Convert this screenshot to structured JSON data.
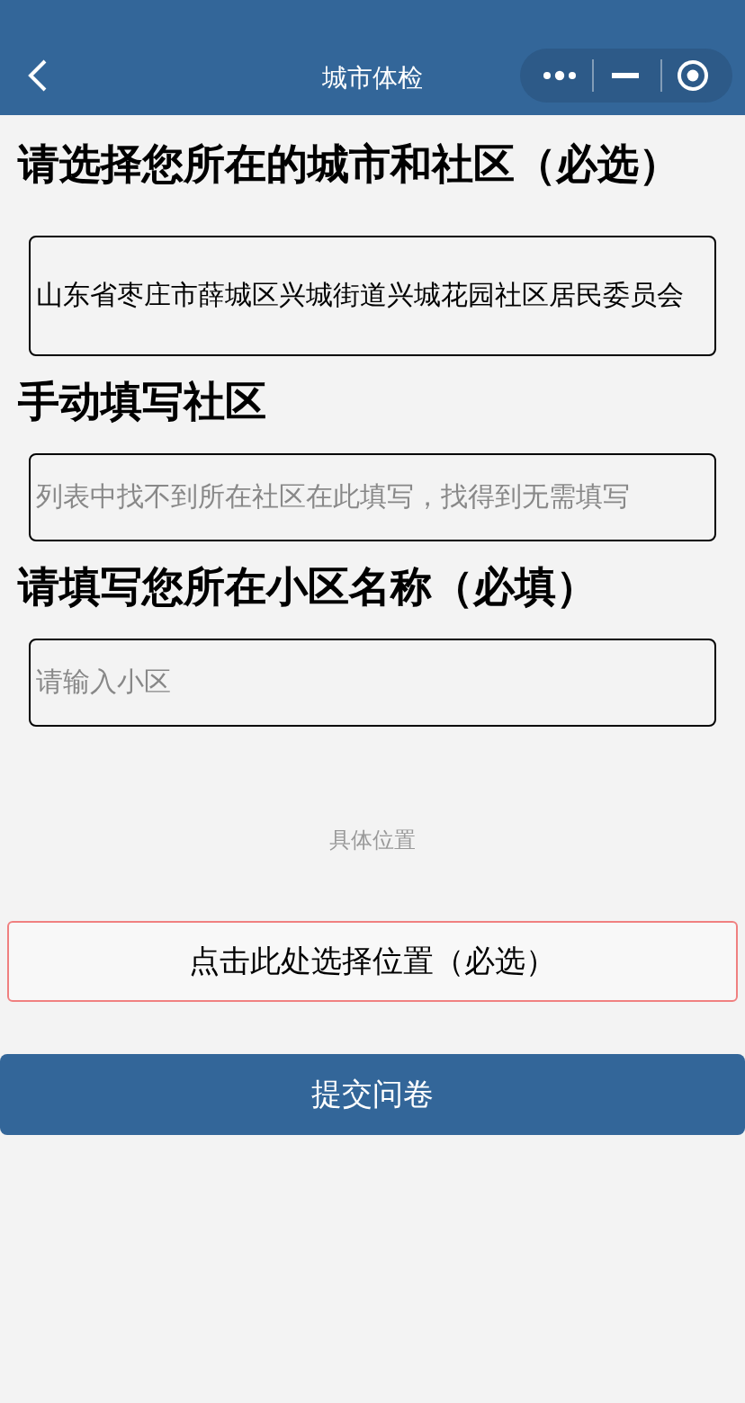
{
  "nav_bar": {
    "title": "城市体检"
  },
  "sections": [
    {
      "heading": "请选择您所在的城市和社区（必选）",
      "kind": "picker",
      "value": "山东省枣庄市薛城区兴城街道兴城花园社区居民委员会"
    },
    {
      "heading": "手动填写社区",
      "kind": "input",
      "placeholder": "列表中找不到所在社区在此填写，找得到无需填写"
    },
    {
      "heading": "请填写您所在小区名称（必填）",
      "kind": "input",
      "placeholder": "请输入小区"
    }
  ],
  "location": {
    "label": "具体位置",
    "button": "点击此处选择位置（必选）"
  },
  "submit_button": "提交问卷"
}
